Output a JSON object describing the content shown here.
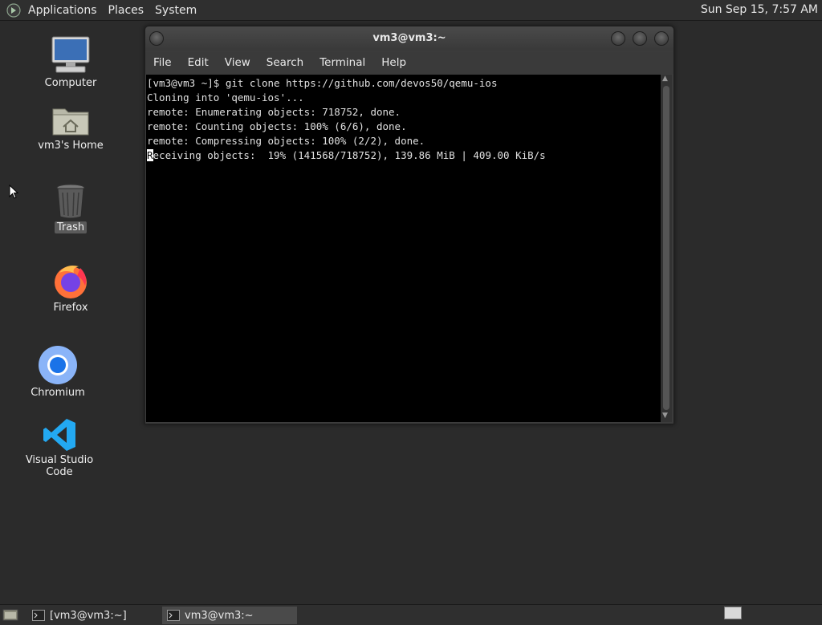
{
  "top_panel": {
    "menu": [
      "Applications",
      "Places",
      "System"
    ],
    "clock": "Sun Sep 15,  7:57 AM"
  },
  "desktop": {
    "icons": [
      {
        "label": "Computer",
        "icon": "computer-icon"
      },
      {
        "label": "vm3's Home",
        "icon": "home-folder-icon"
      },
      {
        "label": "Trash",
        "icon": "trash-icon"
      },
      {
        "label": "Firefox",
        "icon": "firefox-icon"
      },
      {
        "label": "Chromium",
        "icon": "chromium-icon"
      },
      {
        "label": "Visual Studio Code",
        "icon": "vscode-icon"
      }
    ]
  },
  "terminal": {
    "title": "vm3@vm3:~",
    "menu": [
      "File",
      "Edit",
      "View",
      "Search",
      "Terminal",
      "Help"
    ],
    "lines": [
      "[vm3@vm3 ~]$ git clone https://github.com/devos50/qemu-ios",
      "Cloning into 'qemu-ios'...",
      "remote: Enumerating objects: 718752, done.",
      "remote: Counting objects: 100% (6/6), done.",
      "remote: Compressing objects: 100% (2/2), done."
    ],
    "cursor_char": "R",
    "last_line_rest": "eceiving objects:  19% (141568/718752), 139.86 MiB | 409.00 KiB/s"
  },
  "taskbar": {
    "tasks": [
      "[vm3@vm3:~]",
      "vm3@vm3:~"
    ]
  },
  "colors": {
    "panel": "#2f2f2f",
    "desktop": "#2b2b2b",
    "terminal_bg": "#000000",
    "firefox": "#ff7139",
    "chromium": "#4a90e2",
    "vscode": "#23a9f2"
  }
}
